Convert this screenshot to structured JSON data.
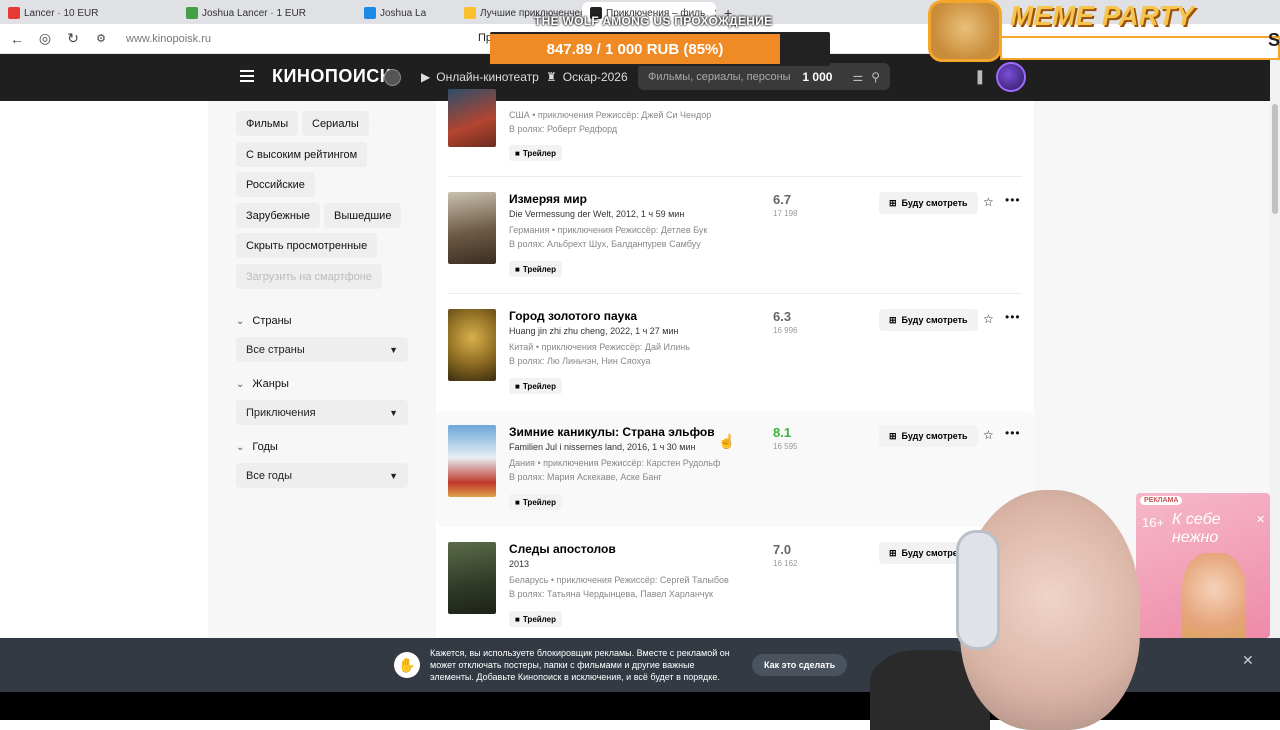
{
  "browser": {
    "tabs": [
      {
        "label": "Lancer · 10 EUR",
        "color": "#e53935"
      },
      {
        "label": "Joshua Lancer · 1 EUR",
        "color": "#43a047"
      },
      {
        "label": "Joshua La",
        "color": "#1e88e5"
      },
      {
        "label": "Лучшие приключенческ",
        "color": "#fbc02d"
      },
      {
        "label": "Приключения – филь",
        "color": "#222222",
        "active": true
      }
    ],
    "url": "www.kinopoisk.ru",
    "page_prefix": "Пр"
  },
  "stream_overlay": {
    "title": "THE WOLF AMONG US ПРОХОЖДЕНИЕ",
    "goal": "847.89 / 1 000 RUB (85%)",
    "meme_text": "MEME PARTY"
  },
  "header": {
    "logo": "КИНОПОИСК",
    "nav_online": "Онлайн-кинотеатр",
    "nav_oscar": "Оскар-2026",
    "search_placeholder": "Фильмы, сериалы, персоны",
    "search_count": "1 000"
  },
  "sidebar": {
    "chips": [
      "Фильмы",
      "Сериалы",
      "С высоким рейтингом",
      "Российские",
      "Зарубежные",
      "Вышедшие",
      "Скрыть просмотренные",
      "Загрузить на смартфоне"
    ],
    "filters": [
      {
        "label": "Страны",
        "value": "Все страны"
      },
      {
        "label": "Жанры",
        "value": "Приключения"
      },
      {
        "label": "Годы",
        "value": "Все годы"
      }
    ]
  },
  "movies": [
    {
      "title": "",
      "subtitle": "",
      "country": "США • приключения  Режиссёр: Джей Си Чендор",
      "cast": "В ролях: Роберт Редфорд",
      "rating": "",
      "votes": ""
    },
    {
      "title": "Измеряя мир",
      "subtitle": "Die Vermessung der Welt, 2012, 1 ч 59 мин",
      "country": "Германия • приключения  Режиссёр: Детлев Бук",
      "cast": "В ролях: Альбрехт Шух, Балданпурев Самбуу",
      "rating": "6.7",
      "votes": "17 198"
    },
    {
      "title": "Город золотого паука",
      "subtitle": "Huang jin zhi zhu cheng, 2022, 1 ч 27 мин",
      "country": "Китай • приключения  Режиссёр: Дай Илинь",
      "cast": "В ролях: Лю Линьчэн, Нин Сяохуа",
      "rating": "6.3",
      "votes": "16 996"
    },
    {
      "title": "Зимние каникулы: Страна эльфов",
      "subtitle": "Familien Jul i nissernes land, 2016, 1 ч 30 мин",
      "country": "Дания • приключения  Режиссёр: Карстен Рудольф",
      "cast": "В ролях: Мария Аскехаве, Аске Банг",
      "rating": "8.1",
      "votes": "16 595"
    },
    {
      "title": "Следы апостолов",
      "subtitle": "2013",
      "country": "Беларусь • приключения  Режиссёр: Сергей Талыбов",
      "cast": "В ролях: Татьяна Чердынцева, Павел Харланчук",
      "rating": "7.0",
      "votes": "16 162"
    }
  ],
  "labels": {
    "trailer": "Трейлер",
    "watch_later": "Буду смотреть"
  },
  "adblock": {
    "message": "Кажется, вы используете блокировщик рекламы. Вместе с рекламой он может отключать постеры, папки с фильмами и другие важные элементы. Добавьте Кинопоиск в исключения, и всё будет в порядке.",
    "button": "Как это сделать"
  },
  "side_ad": {
    "label": "РЕКЛАМА",
    "age": "16+",
    "slogan": "К себе нежно"
  }
}
